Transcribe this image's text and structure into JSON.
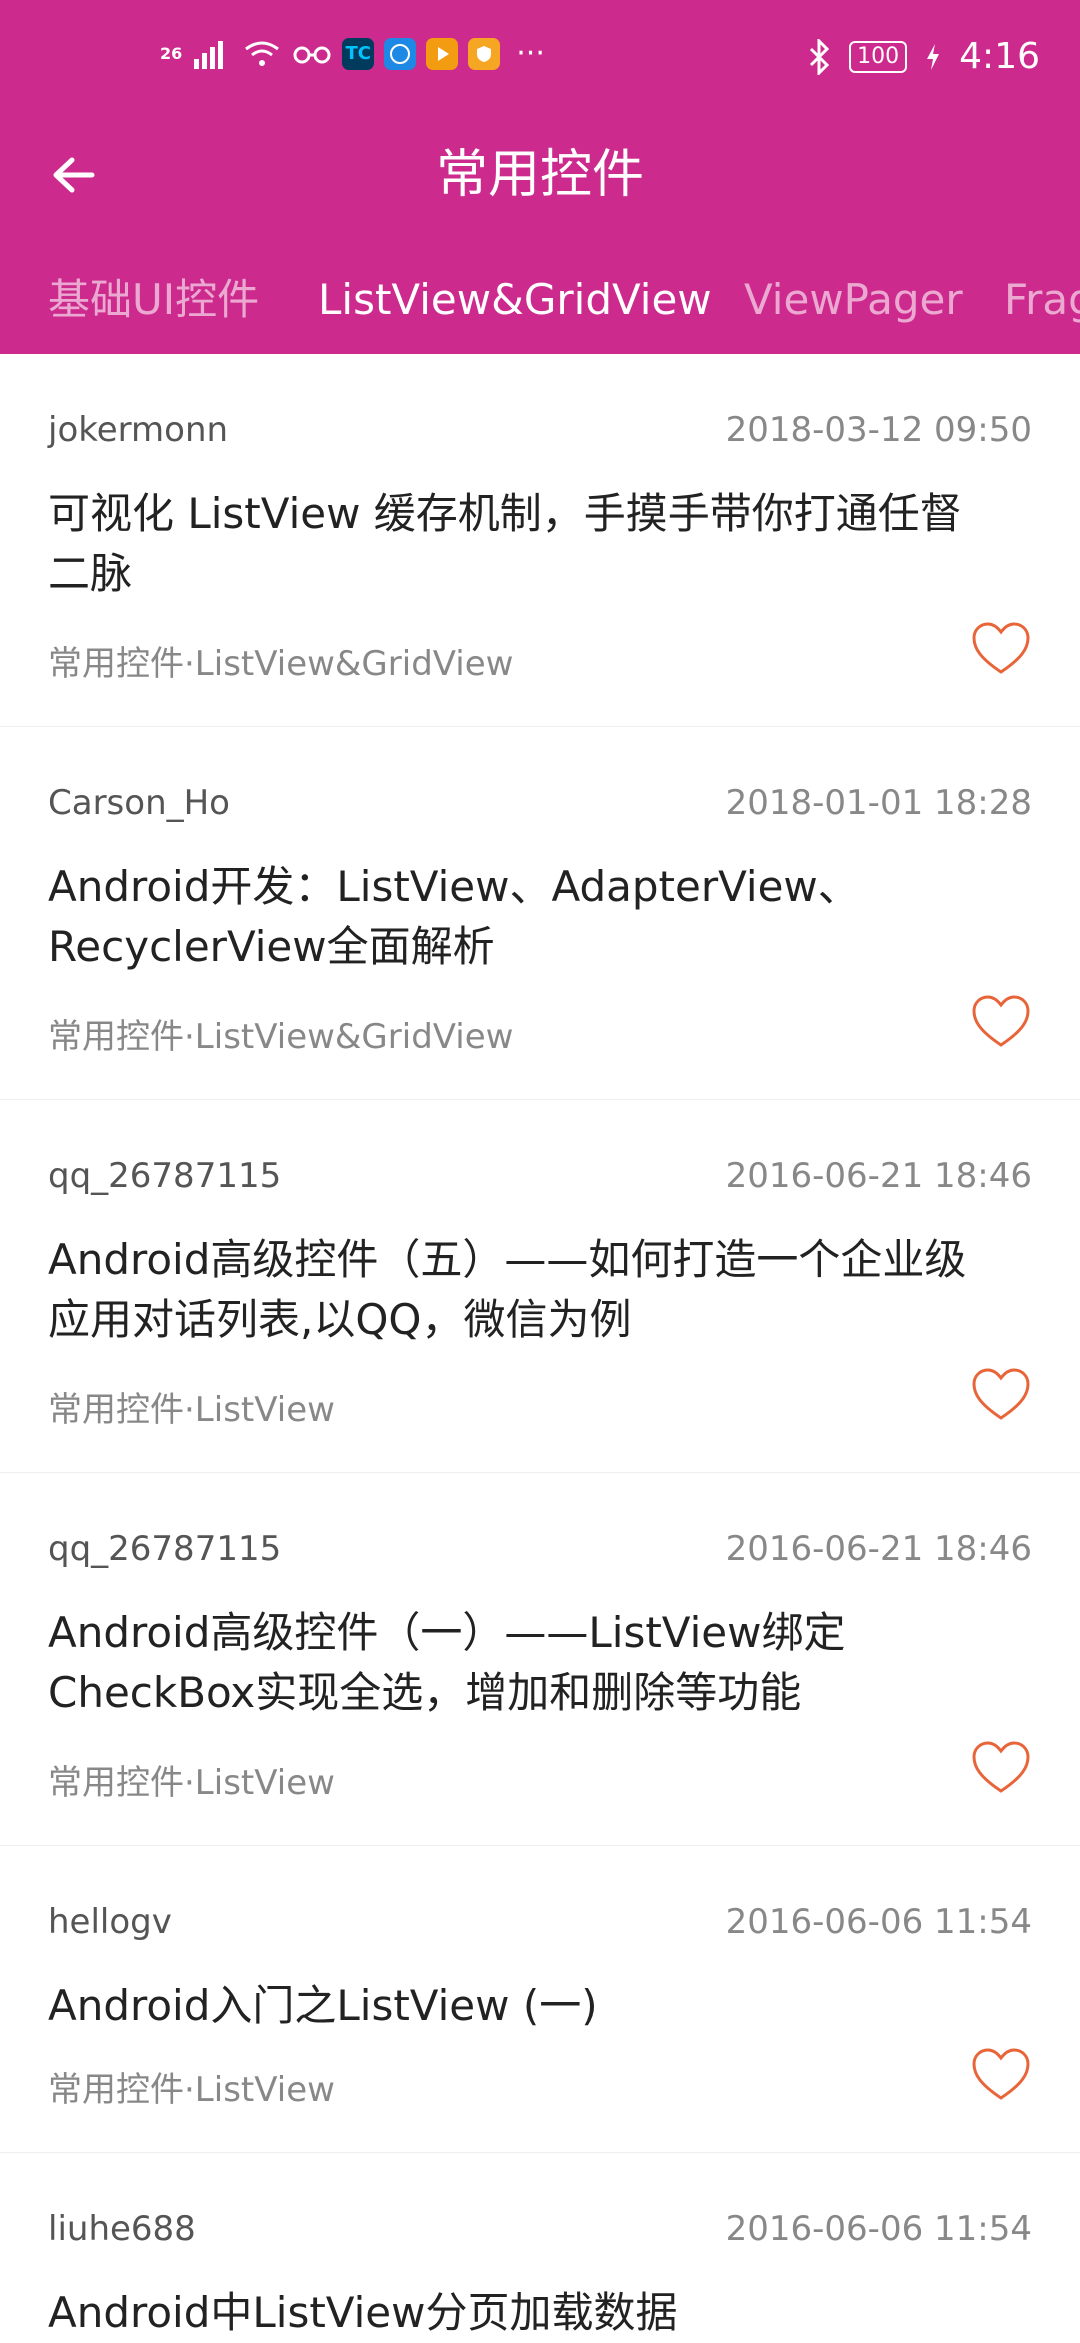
{
  "status_bar": {
    "signal_label": "26",
    "battery": "100",
    "time": "4:16",
    "icons": [
      "signal-icon",
      "wifi-icon",
      "glasses-icon",
      "tc-app-icon",
      "browser-app-icon",
      "video-app-icon",
      "shield-app-icon",
      "more-icon",
      "bluetooth-icon",
      "battery-icon",
      "charging-icon"
    ],
    "ellipsis": "···",
    "tc_label": "TC"
  },
  "app_bar": {
    "title": "常用控件",
    "back_icon": "arrow-left-icon"
  },
  "tabs": [
    {
      "label": "基础UI控件",
      "active": false
    },
    {
      "label": "ListView&GridView",
      "active": true
    },
    {
      "label": "ViewPager",
      "active": false
    },
    {
      "label": "Frag",
      "active": false
    }
  ],
  "articles": [
    {
      "author": "jokermonn",
      "date": "2018-03-12 09:50",
      "title_lines": [
        "可视化 ListView 缓存机制，手摸手带你打通任督",
        "二脉"
      ],
      "category": "常用控件·ListView&GridView"
    },
    {
      "author": "Carson_Ho",
      "date": "2018-01-01 18:28",
      "title_lines": [
        "Android开发：ListView、AdapterView、",
        "RecyclerView全面解析"
      ],
      "category": "常用控件·ListView&GridView"
    },
    {
      "author": "qq_26787115",
      "date": "2016-06-21 18:46",
      "title_lines": [
        "Android高级控件（五）——如何打造一个企业级",
        "应用对话列表,以QQ，微信为例"
      ],
      "category": "常用控件·ListView"
    },
    {
      "author": "qq_26787115",
      "date": "2016-06-21 18:46",
      "title_lines": [
        "Android高级控件（一）——ListView绑定",
        "CheckBox实现全选，增加和删除等功能"
      ],
      "category": "常用控件·ListView"
    },
    {
      "author": "hellogv",
      "date": "2016-06-06 11:54",
      "title_lines": [
        "Android入门之ListView (一)"
      ],
      "category": "常用控件·ListView"
    },
    {
      "author": "liuhe688",
      "date": "2016-06-06 11:54",
      "title_lines": [
        "Android中ListView分页加载数据"
      ],
      "category": ""
    }
  ],
  "colors": {
    "primary": "#CD2A8E",
    "heart": "#E8653A"
  }
}
